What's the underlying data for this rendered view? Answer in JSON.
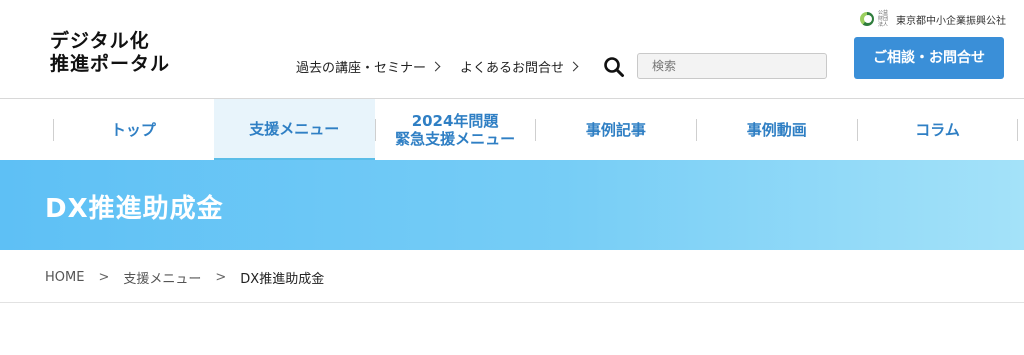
{
  "header": {
    "logo_line1": "デジタル化",
    "logo_line2": "推進ポータル",
    "corp_small": "公益財団法人",
    "corp_name": "東京都中小企業振興公社",
    "links": [
      "過去の講座・セミナー",
      "よくあるお問合せ"
    ],
    "search_placeholder": "検索",
    "cta_label": "ご相談・お問合せ"
  },
  "nav": {
    "items": [
      {
        "label": "トップ"
      },
      {
        "label": "支援メニュー",
        "active": true
      },
      {
        "label_line1": "2024年問題",
        "label_line2": "緊急支援メニュー"
      },
      {
        "label": "事例記事"
      },
      {
        "label": "事例動画"
      },
      {
        "label": "コラム"
      }
    ]
  },
  "hero": {
    "title": "DX推進助成金"
  },
  "breadcrumb": {
    "items": [
      "HOME",
      "支援メニュー",
      "DX推進助成金"
    ],
    "separator": ">"
  },
  "colors": {
    "nav_text": "#2f7fc4",
    "cta_bg": "#3a8fd8",
    "hero_gradient_start": "#5ec0f5",
    "hero_gradient_end": "#a4e2f9"
  }
}
